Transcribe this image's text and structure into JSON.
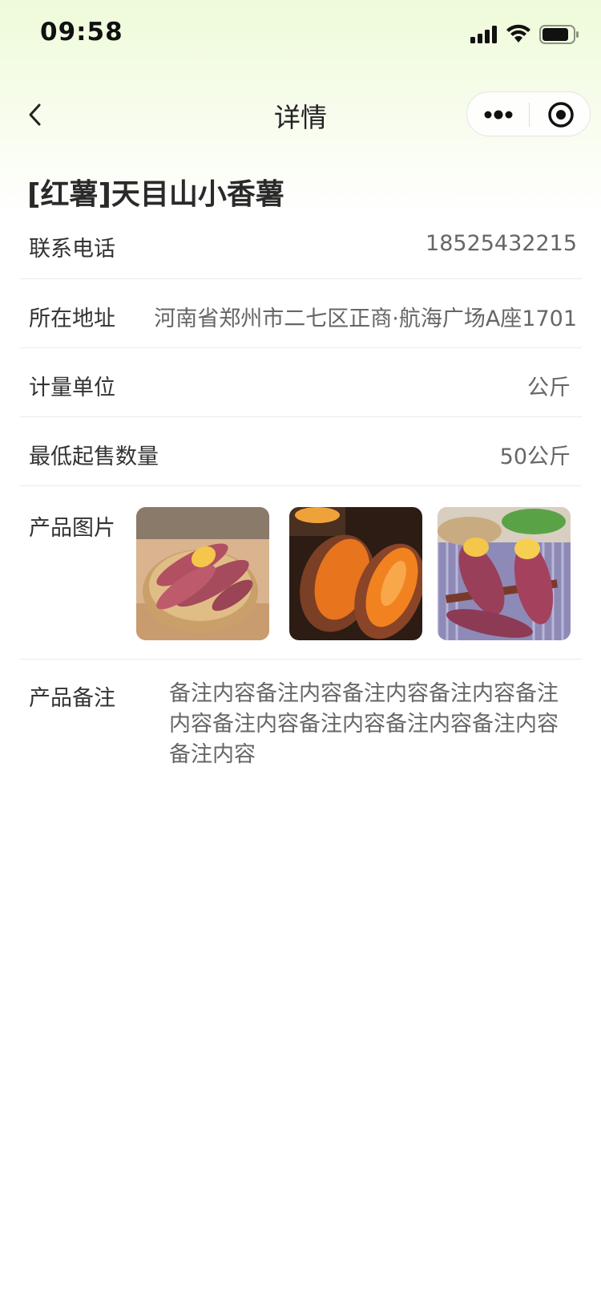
{
  "status_bar": {
    "time": "09:58",
    "icons": [
      "signal-icon",
      "wifi-icon",
      "battery-icon"
    ]
  },
  "nav": {
    "title": "详情",
    "back_icon": "chevron-left-icon",
    "more_icon": "more-dots-icon",
    "close_icon": "target-circle-icon"
  },
  "product": {
    "title": "[红薯]天目山小香薯"
  },
  "details": {
    "phone": {
      "label": "联系电话",
      "value": "18525432215"
    },
    "address": {
      "label": "所在地址",
      "value": "河南省郑州市二七区正商·航海广场A座1701"
    },
    "unit": {
      "label": "计量单位",
      "value": "公斤"
    },
    "min_qty": {
      "label": "最低起售数量",
      "value": "50公斤"
    },
    "images": {
      "label": "产品图片",
      "count": 3
    },
    "remark": {
      "label": "产品备注",
      "value": "备注内容备注内容备注内容备注内容备注内容备注内容备注内容备注内容备注内容备注内容"
    }
  },
  "colors": {
    "header_gradient_top": "#eefbd9",
    "text_primary": "#333333",
    "text_secondary": "#666666",
    "divider": "#ececec"
  }
}
